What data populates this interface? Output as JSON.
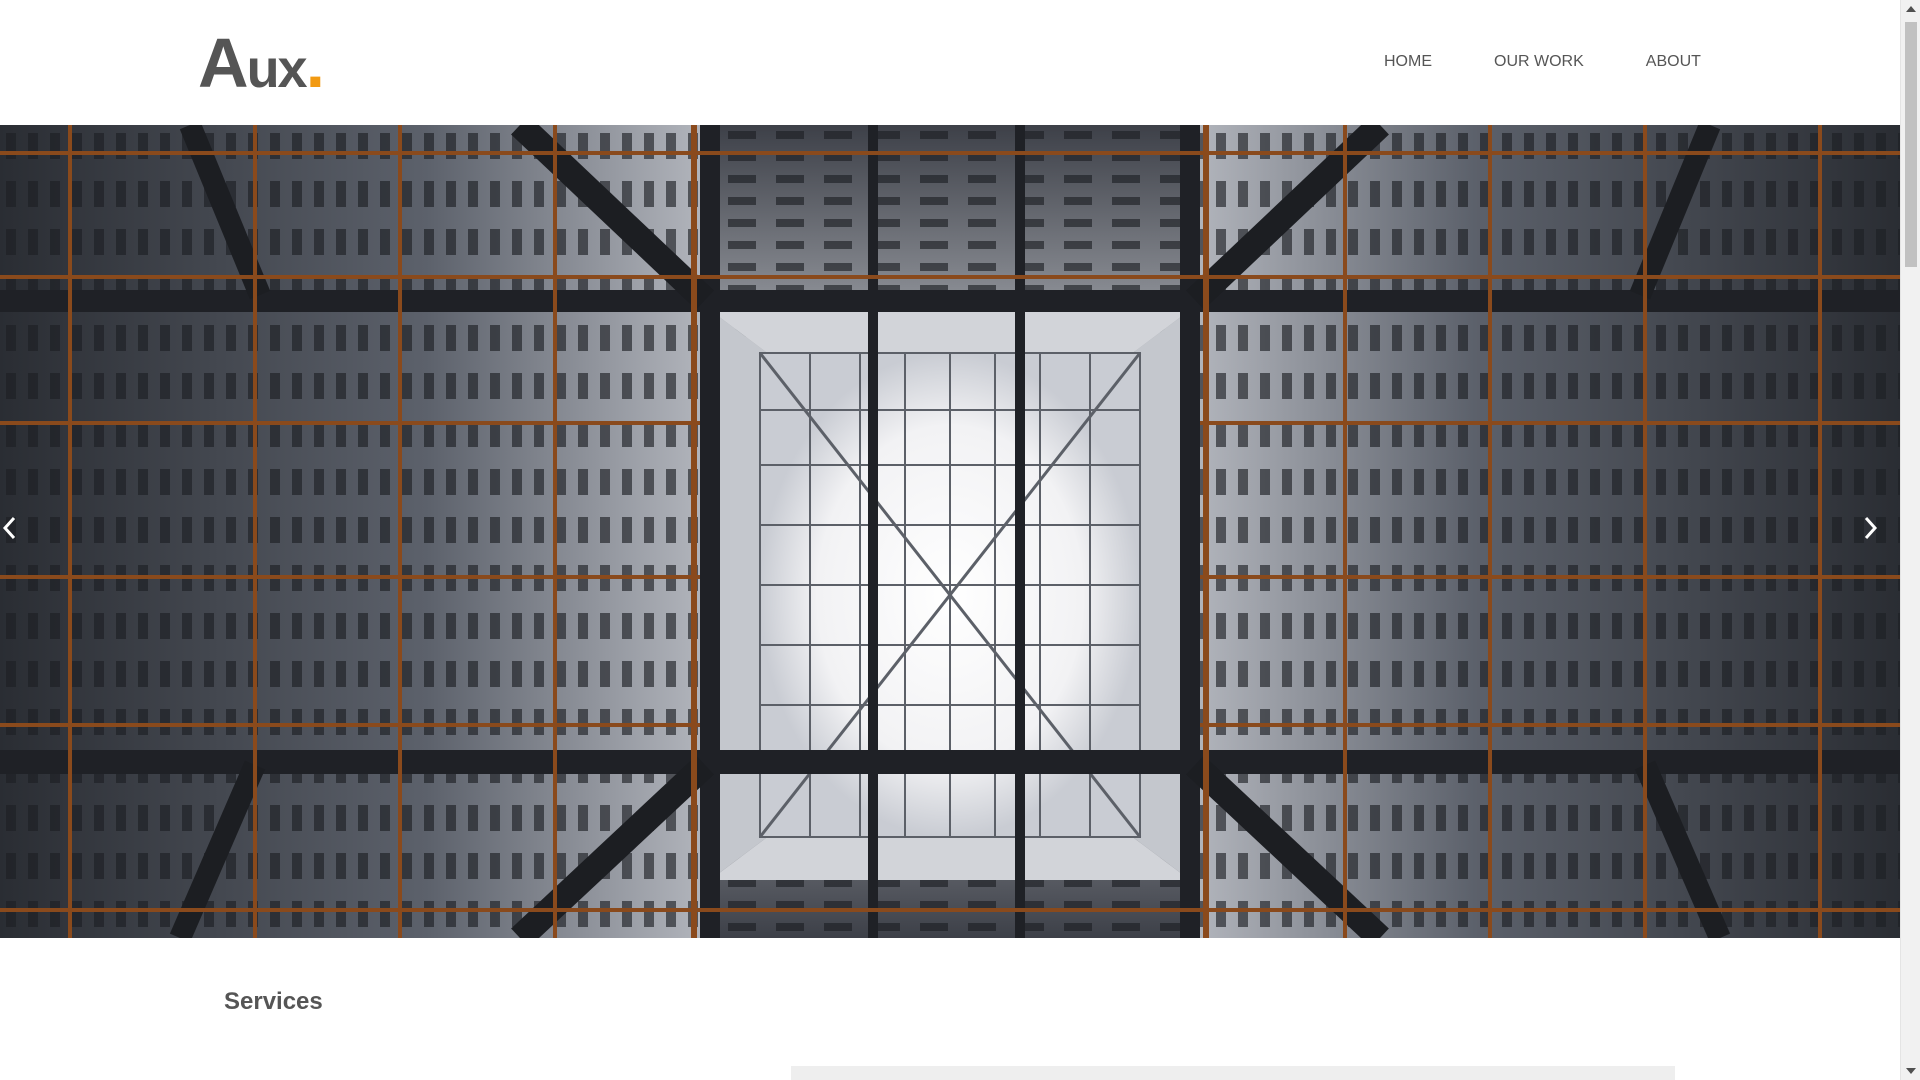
{
  "logo": {
    "letter_a": "A",
    "letters_ux": "ux",
    "dot": "."
  },
  "nav": {
    "items": [
      {
        "label": "HOME"
      },
      {
        "label": "OUR WORK"
      },
      {
        "label": "ABOUT"
      }
    ]
  },
  "hero": {
    "image": "building-atrium-photo",
    "prev_icon": "chevron-left-icon",
    "next_icon": "chevron-right-icon"
  },
  "services": {
    "title": "Services"
  },
  "colors": {
    "accent": "#f29a12",
    "text": "#555555",
    "hero_frame": "#2b2b2f",
    "hero_beam": "#8a4a1c"
  }
}
